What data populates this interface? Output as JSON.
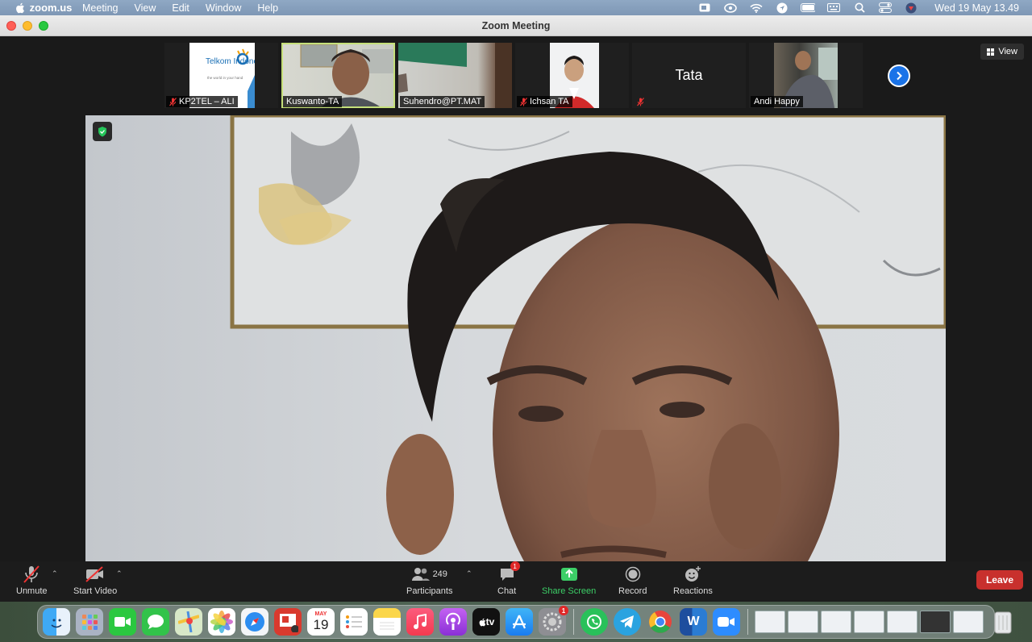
{
  "menubar": {
    "app_name": "zoom.us",
    "menus": [
      "Meeting",
      "View",
      "Edit",
      "Window",
      "Help"
    ],
    "clock": "Wed 19 May  13.49"
  },
  "window": {
    "title": "Zoom Meeting"
  },
  "thumbnails": [
    {
      "name": "KP2TEL – ALI",
      "muted": true,
      "logo_text": "Telkom Indonesia",
      "logo_sub": "the world in your hand"
    },
    {
      "name": "Kuswanto-TA",
      "muted": false,
      "active": true
    },
    {
      "name": "Suhendro@PT.MAT",
      "muted": false
    },
    {
      "name": "Ichsan TA",
      "muted": true
    },
    {
      "name": "",
      "display_name": "Tata",
      "muted": true
    },
    {
      "name": "Andi Happy",
      "muted": false
    }
  ],
  "view_button": "View",
  "toolbar": {
    "unmute": "Unmute",
    "start_video": "Start Video",
    "participants": "Participants",
    "participants_count": "249",
    "chat": "Chat",
    "chat_badge": "1",
    "share_screen": "Share Screen",
    "record": "Record",
    "reactions": "Reactions",
    "leave": "Leave"
  },
  "dock": {
    "calendar_month": "MAY",
    "calendar_day": "19",
    "tv_label": "tv",
    "settings_badge": "1",
    "word_letter": "W"
  },
  "colors": {
    "active_border": "#c5e07a",
    "share_green": "#3ccf67",
    "leave_red": "#c8302d",
    "next_blue": "#1a73e8"
  }
}
